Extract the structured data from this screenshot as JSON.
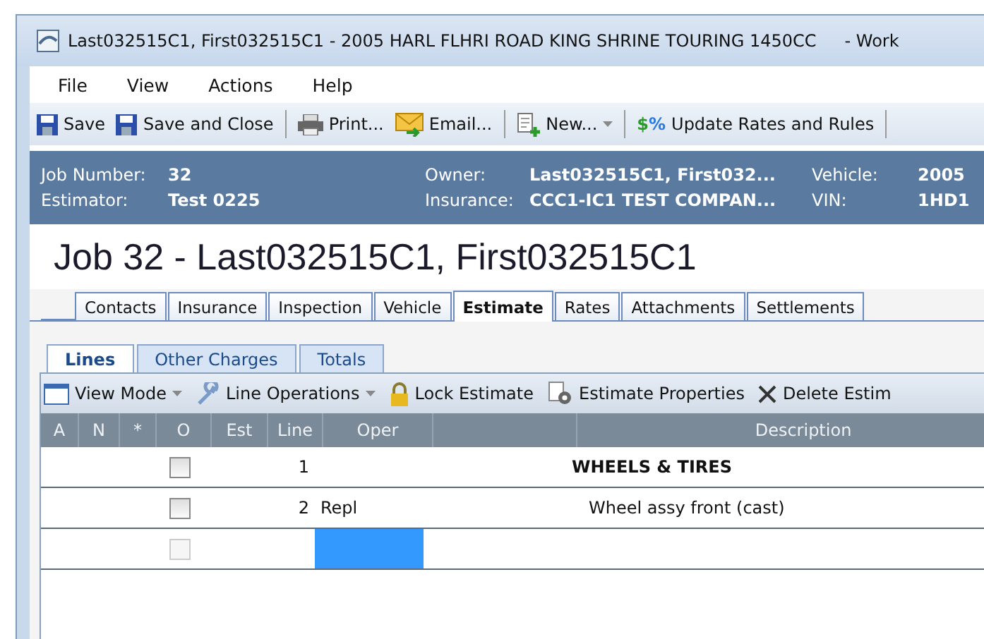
{
  "window": {
    "title": "Last032515C1, First032515C1 - 2005 HARL FLHRI ROAD KING SHRINE TOURING 1450CC",
    "title_suffix": "- Work"
  },
  "menu": [
    "File",
    "View",
    "Actions",
    "Help"
  ],
  "toolbar": [
    {
      "label": "Save",
      "kind": "save"
    },
    {
      "label": "Save and Close",
      "kind": "save"
    },
    {
      "label": "Print...",
      "kind": "print"
    },
    {
      "label": "Email...",
      "kind": "email"
    },
    {
      "label": "New...",
      "kind": "new"
    },
    {
      "label": "Update Rates and Rules",
      "kind": "rates",
      "icon_text": [
        "$",
        "%"
      ]
    }
  ],
  "info": [
    {
      "label": "Job Number:",
      "value": "32"
    },
    {
      "label": "Estimator:",
      "value": "Test 0225"
    },
    {
      "label": "Owner:",
      "value": "Last032515C1, First032..."
    },
    {
      "label": "Insurance:",
      "value": "CCC1-IC1 TEST COMPAN..."
    },
    {
      "label": "Vehicle:",
      "value": "2005"
    },
    {
      "label": "VIN:",
      "value": "1HD1"
    }
  ],
  "heading": "Job 32 - Last032515C1, First032515C1",
  "tabs": [
    {
      "label": "Contacts",
      "selected": false
    },
    {
      "label": "Insurance",
      "selected": false
    },
    {
      "label": "Inspection",
      "selected": false
    },
    {
      "label": "Vehicle",
      "selected": false
    },
    {
      "label": "Estimate",
      "selected": true
    },
    {
      "label": "Rates",
      "selected": false
    },
    {
      "label": "Attachments",
      "selected": false
    },
    {
      "label": "Settlements",
      "selected": false
    }
  ],
  "subtabs": [
    {
      "label": "Lines",
      "selected": true
    },
    {
      "label": "Other Charges",
      "selected": false
    },
    {
      "label": "Totals",
      "selected": false
    }
  ],
  "estimate_toolbar": [
    {
      "label": "View Mode",
      "kind": "view"
    },
    {
      "label": "Line Operations",
      "kind": "ops"
    },
    {
      "label": "Lock Estimate",
      "kind": "lock"
    },
    {
      "label": "Estimate Properties",
      "kind": "props"
    },
    {
      "label": "Delete Estim",
      "kind": "delete"
    }
  ],
  "table": {
    "columns": [
      "A",
      "N",
      "*",
      "O",
      "Est",
      "Line",
      "Oper",
      "",
      "Description"
    ],
    "rows": [
      {
        "line": "1",
        "description": "WHEELS & TIRES",
        "kind": "header",
        "checked": false,
        "selected": false
      },
      {
        "line": "2",
        "oper": "Repl",
        "description": "Wheel assy front (cast)",
        "kind": "item",
        "checked": false,
        "selected": false
      },
      {
        "kind": "new",
        "checked": false,
        "selected": true
      }
    ]
  }
}
